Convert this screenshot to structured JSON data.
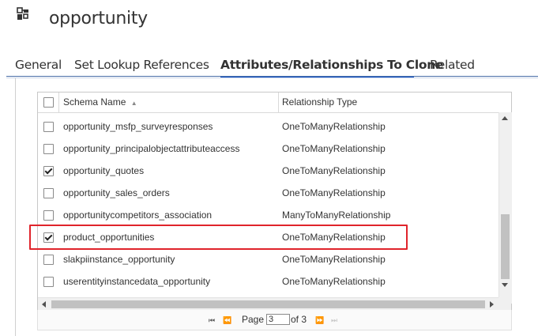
{
  "header": {
    "title": "opportunity",
    "icon": "entity-icon"
  },
  "tabs": [
    {
      "label": "General",
      "active": false
    },
    {
      "label": "Set Lookup References",
      "active": false
    },
    {
      "label": "Attributes/Relationships To Clone",
      "active": true
    },
    {
      "label": "Related",
      "active": false
    }
  ],
  "grid": {
    "columns": {
      "schema_name": "Schema Name",
      "sort_indicator": "▲",
      "relationship_type": "Relationship Type"
    },
    "rows": [
      {
        "name": "opportunity_msfp_surveyresponses",
        "type": "OneToManyRelationship",
        "checked": false
      },
      {
        "name": "opportunity_principalobjectattributeaccess",
        "type": "OneToManyRelationship",
        "checked": false
      },
      {
        "name": "opportunity_quotes",
        "type": "OneToManyRelationship",
        "checked": true
      },
      {
        "name": "opportunity_sales_orders",
        "type": "OneToManyRelationship",
        "checked": false
      },
      {
        "name": "opportunitycompetitors_association",
        "type": "ManyToManyRelationship",
        "checked": false
      },
      {
        "name": "product_opportunities",
        "type": "OneToManyRelationship",
        "checked": true
      },
      {
        "name": "slakpiinstance_opportunity",
        "type": "OneToManyRelationship",
        "checked": false
      },
      {
        "name": "userentityinstancedata_opportunity",
        "type": "OneToManyRelationship",
        "checked": false
      }
    ]
  },
  "pager": {
    "first_icon": "⏮",
    "prev_icon": "⏪",
    "page_label": "Page",
    "current_page": "3",
    "of_label": "of 3",
    "next_icon": "⏩",
    "last_icon": "⏭"
  },
  "colors": {
    "accent": "#1a56c4",
    "highlight": "#e0242b"
  }
}
